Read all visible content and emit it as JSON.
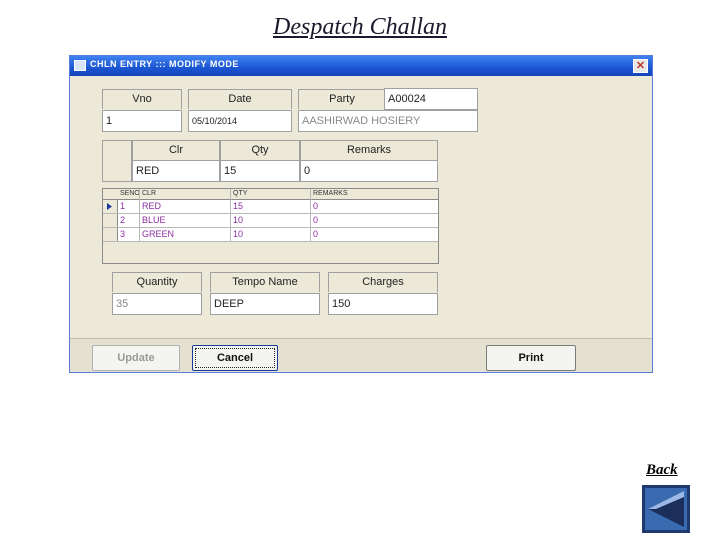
{
  "slide": {
    "title": "Despatch Challan",
    "back_label": "Back"
  },
  "window": {
    "title": "CHLN ENTRY ::: MODIFY MODE",
    "close_glyph": "✕"
  },
  "header_fields": {
    "vno_label": "Vno",
    "date_label": "Date",
    "party_label": "Party",
    "party_code": "A00024",
    "vno": "1",
    "date": "05/10/2014",
    "party_name": "AASHIRWAD HOSIERY"
  },
  "line_entry": {
    "clr_label": "Clr",
    "qty_label": "Qty",
    "remarks_label": "Remarks",
    "clr": "RED",
    "qty": "15",
    "remarks": "0"
  },
  "grid": {
    "columns": [
      "SENO",
      "CLR",
      "QTY",
      "REMARKS"
    ],
    "rows": [
      {
        "seno": "1",
        "clr": "RED",
        "qty": "15",
        "remarks": "0"
      },
      {
        "seno": "2",
        "clr": "BLUE",
        "qty": "10",
        "remarks": "0"
      },
      {
        "seno": "3",
        "clr": "GREEN",
        "qty": "10",
        "remarks": "0"
      }
    ]
  },
  "totals": {
    "quantity_label": "Quantity",
    "tempo_label": "Tempo Name",
    "charges_label": "Charges",
    "quantity": "35",
    "tempo": "DEEP",
    "charges": "150"
  },
  "buttons": {
    "update": "Update",
    "cancel": "Cancel",
    "print": "Print"
  },
  "colors": {
    "titlebar": "#1c55d2",
    "grid_text": "#8b2fa0",
    "window_bg": "#ece9d8"
  }
}
